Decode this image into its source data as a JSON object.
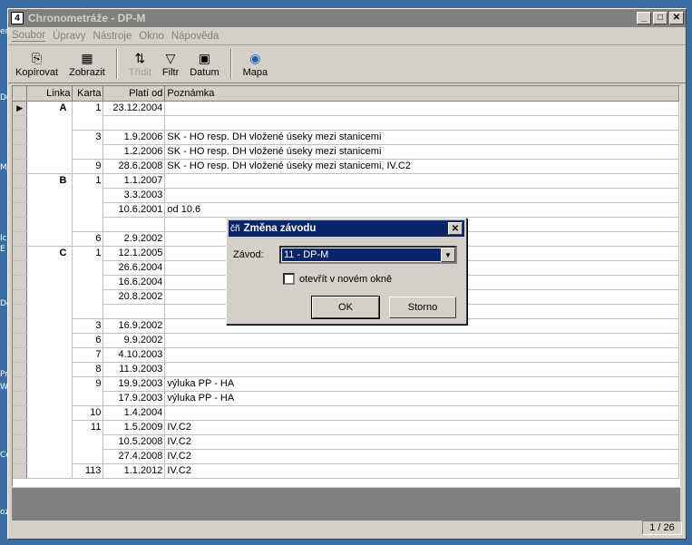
{
  "window": {
    "icon_text": "4",
    "title": "Chronometráže - DP-M"
  },
  "window_controls": {
    "minimize": "_",
    "maximize": "□",
    "close": "✕"
  },
  "menu": [
    "Soubor",
    "Úpravy",
    "Nástroje",
    "Okno",
    "Nápověda"
  ],
  "toolbar": [
    {
      "label": "Kopírovat",
      "icon": "copy-icon",
      "glyph": "⎘",
      "enabled": true
    },
    {
      "label": "Zobrazit",
      "icon": "grid-icon",
      "glyph": "▦",
      "enabled": true
    },
    {
      "label": "Třídit",
      "icon": "sort-icon",
      "glyph": "⇅",
      "enabled": false
    },
    {
      "label": "Filtr",
      "icon": "filter-icon",
      "glyph": "▽",
      "enabled": true
    },
    {
      "label": "Datum",
      "icon": "calendar-icon",
      "glyph": "▣",
      "enabled": true
    },
    {
      "label": "Mapa",
      "icon": "globe-icon",
      "glyph": "◉",
      "enabled": true
    }
  ],
  "table": {
    "columns": [
      "Linka",
      "Karta",
      "Platí od",
      "Poznámka"
    ],
    "rows": [
      [
        "A",
        "1",
        "23.12.2004",
        ""
      ],
      [
        "",
        "",
        "",
        ""
      ],
      [
        "",
        "3",
        "1.9.2006",
        "SK - HO  resp. DH vložené  úseky mezi stanicemi"
      ],
      [
        "",
        "",
        "1.2.2006",
        "SK - HO  resp. DH vložené  úseky mezi stanicemi"
      ],
      [
        "",
        "9",
        "28.6.2008",
        "SK - HO  resp. DH vložené  úseky mezi stanicemi, IV.C2"
      ],
      [
        "B",
        "1",
        "1.1.2007",
        ""
      ],
      [
        "",
        "",
        "3.3.2003",
        ""
      ],
      [
        "",
        "",
        "10.6.2001",
        "od 10.6"
      ],
      [
        "",
        "",
        "",
        ""
      ],
      [
        "",
        "6",
        "2.9.2002",
        ""
      ],
      [
        "C",
        "1",
        "12.1.2005",
        ""
      ],
      [
        "",
        "",
        "26.6.2004",
        ""
      ],
      [
        "",
        "",
        "16.6.2004",
        ""
      ],
      [
        "",
        "",
        "20.8.2002",
        ""
      ],
      [
        "",
        "",
        "",
        ""
      ],
      [
        "",
        "3",
        "16.9.2002",
        ""
      ],
      [
        "",
        "6",
        "9.9.2002",
        ""
      ],
      [
        "",
        "7",
        "4.10.2003",
        ""
      ],
      [
        "",
        "8",
        "11.9.2003",
        ""
      ],
      [
        "",
        "9",
        "19.9.2003",
        "výluka PP - HA"
      ],
      [
        "",
        "",
        "17.9.2003",
        "výluka PP - HA"
      ],
      [
        "",
        "10",
        "1.4.2004",
        ""
      ],
      [
        "",
        "11",
        "1.5.2009",
        "IV.C2"
      ],
      [
        "",
        "",
        "10.5.2008",
        "IV.C2"
      ],
      [
        "",
        "",
        "27.4.2008",
        "IV.C2"
      ],
      [
        "",
        "113",
        "1.1.2012",
        "IV.C2"
      ]
    ]
  },
  "status": {
    "record": "1 / 26"
  },
  "dialog": {
    "icon": "čñ",
    "title": "Změna závodu",
    "close": "✕",
    "field_label": "Závod:",
    "field_value": "11 - DP-M",
    "checkbox_label": "otevřít v novém okně",
    "ok_label": "OK",
    "cancel_label": "Storno"
  },
  "desktop_fragments": [
    "en",
    "Do",
    "Mj",
    "Ic",
    "E",
    "De",
    "Pr",
    "W",
    "Co",
    "oz"
  ]
}
